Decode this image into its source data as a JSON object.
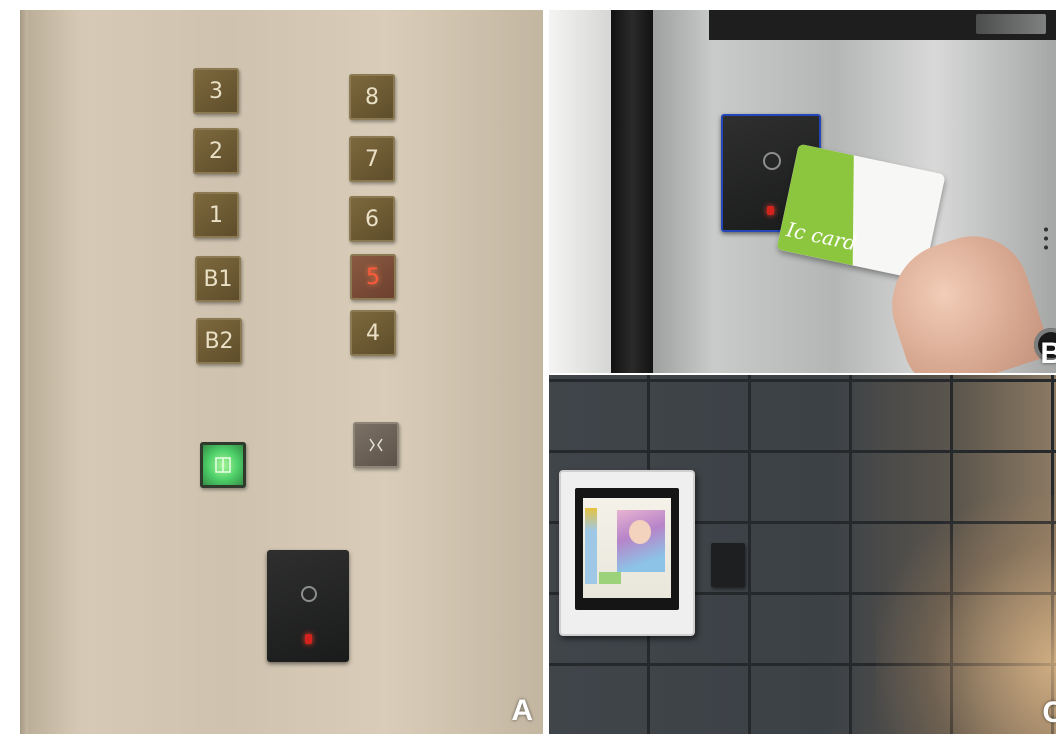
{
  "panels": {
    "a": {
      "label": "A",
      "buttons_left": [
        "3",
        "2",
        "1",
        "B1",
        "B2"
      ],
      "buttons_right": [
        "8",
        "7",
        "6",
        "5",
        "4"
      ],
      "lit_floor": "5",
      "door_open_icon": "door-open-icon",
      "door_close_icon": "door-close-icon"
    },
    "b": {
      "label": "B",
      "card_text": "Ic card"
    },
    "c": {
      "label": "C"
    }
  },
  "colors": {
    "lit_button": "#ff5a3c",
    "open_button": "#4fd06a",
    "card_green": "#8cc63e",
    "reader_led": "#d3231c"
  }
}
